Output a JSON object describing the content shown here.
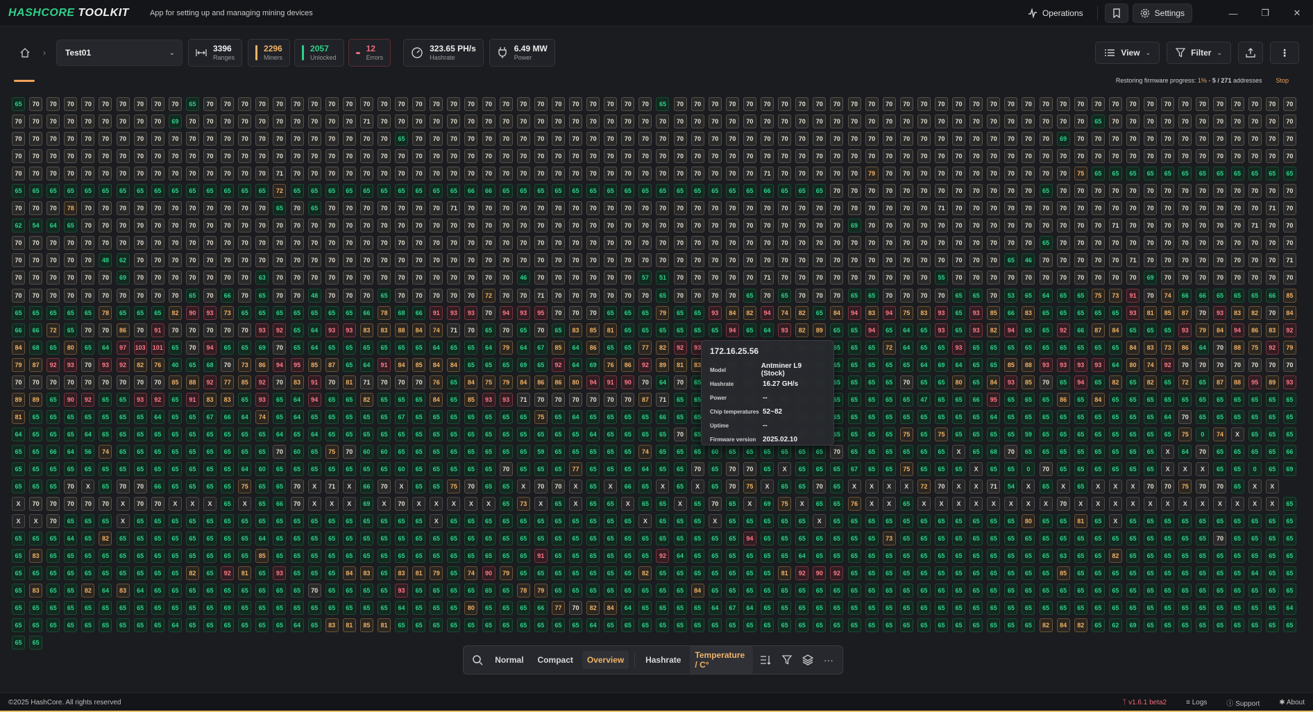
{
  "app": {
    "logo_a": "HASHCORE",
    "logo_b": "TOOLKIT",
    "tagline": "App for setting up and managing mining devices"
  },
  "titlebar": {
    "operations_label": "Operations",
    "settings_label": "Settings"
  },
  "toolbar": {
    "scan_select": "Test01",
    "stats": {
      "ranges": {
        "value": "3396",
        "label": "Ranges"
      },
      "miners": {
        "value": "2296",
        "label": "Miners"
      },
      "unlocked": {
        "value": "2057",
        "label": "Unlocked"
      },
      "errors": {
        "value": "12",
        "label": "Errors"
      },
      "hashrate": {
        "value": "323.65 PH/s",
        "label": "Hashrate"
      },
      "power": {
        "value": "6.49 MW",
        "label": "Power"
      }
    },
    "view_label": "View",
    "filter_label": "Filter"
  },
  "progress": {
    "prefix": "Restoring firmware progress: ",
    "percent": "1%",
    "sep": " - ",
    "count": "5 / 271",
    "suffix": " addresses",
    "stop_label": "Stop",
    "fraction": 0.01
  },
  "grid": {
    "rows": [
      "65 70 70 70 70 70 70 70 70 70 65 70 70 70 70 70 70 70 70 70 70 70 70 70 70 70 70 70 70 70 70 70 70 70 70 70 70 65 70 70 70 70 70 70 70 70 70 70 70 70 70 70 70 70 70 70 70 70 70 70 70 70 70 70 70 70 70 70 70 70 70 70 70 70",
      "70 70 70 70 70 70 70 70 70 69 70 70 70 70 70 70 70 70 70 70 71 70 70 70 70 70 70 70 70 70 70 70 70 70 70 70 70 70 70 70 70 70 70 70 70 70 70 70 70 70 70 70 70 70 70 70 70 70 70 70 70 70 65 70 70 70 70 70 70 70 70 70 70 70",
      "70 70 70 70 70 70 70 70 70 70 70 70 70 70 70 70 70 70 70 70 70 70 65 70 70 70 70 70 70 70 70 70 70 70 70 70 70 70 70 70 70 70 70 70 70 70 70 70 70 70 70 70 70 70 70 70 70 70 70 70 69 70 70 70 70 70 70 70 70 70 70 70 70 70",
      "70 70 70 70 70 70 70 70 70 70 70 70 70 70 70 70 70 70 70 70 70 70 70 70 70 70 70 70 70 70 70 70 70 70 70 70 70 70 70 70 70 70 70 70 70 70 70 70 70 70 70 70 70 70 70 70 70 70 70 70 70 70 70 70 70 70 70 70 70 70 70 70 70 70",
      "70 70 70 70 70 70 70 70 70 70 70 70 70 70 70 71 70 70 70 70 70 70 70 70 70 70 70 70 70 70 70 70 70 70 70 70 70 70 70 70 70 70 70 71 70 70 70 70 70 79 70 70 70 70 70 70 70 70 70 70 70 75 65 65 65 65 65 65 65 65 65 65 65 65",
      "65 65 65 65 65 65 65 65 65 65 65 65 65 65 65 72 65 65 65 65 65 65 65 65 65 65 66 66 65 65 65 65 65 65 65 65 65 65 65 65 65 65 65 66 65 65 65 70 70 70 70 70 70 70 70 70 70 70 70 65 70 70 70 70 70 70 70 70 70 70 70 70 70 70",
      "70 70 70 78 70 70 70 70 70 70 70 70 70 70 70 65 70 65 70 70 70 70 70 70 70 71 70 70 70 70 70 70 70 70 70 70 70 70 70 70 70 70 70 70 70 70 70 70 70 70 70 70 70 71 70 70 70 70 70 70 70 70 70 70 70 70 70 70 70 70 70 70 71 70",
      "62 54 64 65 70 70 70 70 70 70 70 70 70 70 70 70 70 70 70 70 70 70 70 70 70 70 70 70 70 70 70 70 70 70 70 70 70 70 70 70 70 70 70 70 70 70 70 70 69 70 70 70 70 70 70 70 70 70 70 70 70 70 70 71 70 70 70 70 70 70 70 71 70 70",
      "70 70 70 70 70 70 70 70 70 70 70 70 70 70 70 70 70 70 70 70 70 70 70 70 70 70 70 70 70 70 70 70 70 70 70 70 70 70 70 70 70 70 70 70 70 70 70 70 70 70 70 70 70 70 70 70 70 70 70 65 70 70 70 70 70 70 70 70 70 70 70 70 70 70",
      "70 70 70 70 70 48 62 70 70 70 70 70 70 70 70 70 70 70 70 70 70 70 70 70 70 70 70 70 70 70 70 70 70 70 70 70 70 70 70 70 70 70 70 70 70 70 70 70 70 70 70 70 70 70 70 70 70 65 46 70 70 70 70 70 71 70 70 70 70 70 70 70 70 71",
      "70 70 70 70 70 70 69 70 70 70 70 70 70 70 63 70 70 70 70 70 70 70 70 70 70 70 70 70 70 46 70 70 70 70 70 70 57 51 70 70 70 70 70 71 70 70 70 70 70 70 70 70 70 55 70 70 70 70 70 70 70 70 70 70 70 69 70 70 70 70 70 70 70 70",
      "70 70 70 70 70 70 70 70 70 70 65 70 66 70 65 70 70 48 70 70 70 65 70 70 70 70 70 72 70 70 71 70 70 70 70 70 70 65 70 70 70 70 65 70 65 70 70 70 65 65 70 70 70 70 65 65 70 53 65 64 65 65 75 73 91 70 74 66 66 65 65 65 66 85",
      "65 65 65 65 65 78 65 65 65 82 90 93 73 65 65 65 65 65 65 65 66 78 68 66 91 93 93 70 94 93 95 70 70 70 65 65 65 79 65 65 93 84 82 94 74 82 65 84 94 83 94 75 83 93 65 93 85 66 83 65 65 65 65 65 93 81 85 87 70 93 83 82 70 84",
      "66 66 72 65 70 70 86 70 91 70 70 70 70 70 93 92 65 64 93 93 83 83 88 84 74 71 70 65 70 65 70 65 83 85 81 65 65 65 65 65 65 94 65 64 93 82 89 65 65 94 65 64 65 93 65 93 82 94 65 65 92 66 87 84 65 65 65 93 79 84 94 86 83 92",
      "84 68 65 80 65 64 97 103 101 65 70 94 65 65 69 70 65 64 65 65 65 65 65 65 64 65 65 64 79 64 67 85 64 86 65 65 77 82 92 93 65 65 65 65 65 65 65 65 65 65 72 64 65 65 93 65 65 65 65 65 65 65 65 65 84 83 73 86 64 70 88 75 92 79",
      "79 87 92 93 70 93 92 82 76 40 65 68 70 73 86 94 95 85 87 65 64 91 84 85 84 84 65 65 65 69 65 92 64 69 76 86 92 89 81 83 65 65 65 65 65 65 65 65 65 65 65 65 64 69 64 65 65 85 88 93 93 93 93 64 80 74 92 70 70 70 70 70 70 70",
      "70 70 70 70 70 70 70 70 70 85 88 92 77 85 92 70 83 91 70 81 71 70 70 70 76 65 84 75 79 84 86 86 80 94 91 90 70 64 70 65 65 65 65 65 65 65 65 65 65 65 65 70 65 65 80 65 84 93 85 70 65 94 65 82 65 82 65 72 65 87 88 95 89 93",
      "89 89 65 90 92 65 65 93 92 65 91 83 83 65 93 65 64 94 65 65 82 65 65 65 84 65 85 93 93 71 70 70 70 70 70 70 87 71 65 65 65 65 65 65 65 65 65 65 65 65 65 65 47 65 65 66 95 65 65 65 86 65 84 65 65 65 65 65 65 65 65 65 65 65",
      "81 65 65 65 65 65 65 65 64 65 65 67 66 64 74 65 64 65 65 65 65 65 67 65 65 65 65 65 65 65 75 65 64 65 65 65 65 66 65 65 65 65 65 65 65 65 65 65 65 65 65 65 65 65 65 65 64 65 65 65 65 65 65 65 65 65 64 70 65 65 65 65 65 65",
      "64 65 65 65 64 65 65 65 65 65 65 65 65 65 65 64 65 64 65 65 65 65 65 65 65 65 65 65 65 65 65 65 65 64 65 65 65 65 70 65 65 65 65 65 65 65 65 65 65 65 65 75 65 75 65 65 65 65 59 65 65 65 65 65 65 65 65 75 0 74 X 65 65 65",
      "65 65 66 64 56 74 65 65 65 65 65 65 65 65 65 70 60 65 75 70 60 60 65 65 65 65 65 65 65 65 59 65 65 65 65 65 74 65 65 65 60 65 65 65 65 65 65 70 65 65 65 65 65 65 X 65 68 70 65 65 65 65 65 65 65 65 X 64 70 65 65 65 65 66",
      "65 65 65 65 65 65 65 65 65 65 65 65 65 64 60 65 65 65 65 65 65 65 60 65 65 65 65 65 70 65 65 65 77 65 65 65 64 65 65 70 65 70 70 65 X 65 65 65 67 65 65 75 65 65 65 X 65 65 0 70 65 65 65 65 65 65 X X X 65 65 0 65 69",
      "65 65 65 70 X 65 70 70 66 65 65 65 65 75 65 65 70 X 71 X 66 70 X 65 65 75 70 65 65 X 70 70 X 65 X 66 65 X 65 X 65 70 75 X 65 65 70 65 X X X X 72 70 X X 71 54 X 65 X 65 X X X 70 70 75 70 70 65 X X",
      "X 70 70 70 70 70 X 70 70 X X X 65 X 65 66 70 X X X 69 X 70 X X X X X 65 73 X 65 X 65 65 X 65 65 X 65 70 65 X 69 75 X 65 65 76 X X 65 X X X X X X X X 70 X X X X X X X X X X X X 65",
      "X X 70 65 65 65 X 65 65 65 65 65 65 65 65 65 65 65 65 65 65 65 65 65 X 65 65 65 65 65 65 65 65 65 65 65 X 65 65 65 X 65 65 65 65 65 X 65 65 65 65 65 65 65 65 65 65 65 80 65 65 81 65 X 65 65 65 65 65 65 65 65 65 65",
      "65 65 65 64 65 82 65 65 65 65 65 65 65 65 64 65 65 65 65 65 65 65 65 65 65 65 65 65 65 65 65 65 65 65 65 65 65 65 65 65 65 65 94 65 65 65 65 65 65 65 73 65 65 65 65 65 65 65 65 65 65 65 65 65 65 65 65 65 65 70 65 65 65 65",
      "65 83 65 65 65 65 65 65 65 65 65 65 65 65 85 65 65 65 65 65 65 65 65 65 65 65 65 65 65 65 91 65 65 65 65 65 65 92 64 65 65 65 65 65 65 64 65 65 65 65 65 65 65 65 65 65 65 65 65 65 63 65 65 82 65 65 65 65 65 65 65 65 65 65",
      "65 65 65 65 65 65 65 65 65 65 82 65 92 81 65 93 65 65 65 84 83 65 83 81 79 65 74 90 79 65 65 65 65 65 65 65 82 65 65 65 65 65 65 65 81 92 90 92 65 65 65 65 65 65 65 65 65 65 65 65 85 65 65 65 65 65 65 65 65 65 65 64 65 65",
      "65 83 65 65 82 64 83 64 65 65 65 65 65 65 65 65 65 70 65 65 65 65 93 65 65 65 65 65 65 78 79 65 65 65 65 65 65 65 65 84 65 65 65 65 65 65 65 65 65 65 65 65 65 65 65 65 65 65 65 65 65 65 65 65 65 65 65 65 65 65 65 65 65 65",
      "65 65 65 65 65 65 65 65 65 65 65 65 69 65 65 65 65 65 65 65 65 65 64 65 65 65 80 65 65 65 66 77 70 82 84 64 65 65 65 65 64 67 64 65 65 65 65 65 65 65 65 65 65 65 65 65 65 65 65 65 65 65 65 65 65 65 65 65 65 65 65 65 65 64",
      "65 65 65 65 65 65 65 65 65 64 65 65 65 65 65 65 64 65 83 81 85 81 65 65 65 65 65 65 65 65 65 65 65 64 65 65 65 65 65 65 65 65 65 65 65 65 65 65 65 65 65 65 65 65 65 65 65 65 65 82 84 82 65 62 69 65 65 65 65 65 65 65 65 65",
      "65 65"
    ]
  },
  "tooltip": {
    "ip": "172.16.25.56",
    "model_key": "Model",
    "model_val": "Antminer L9 (Stock)",
    "hashrate_key": "Hashrate",
    "hashrate_val": "16.27 GH/s",
    "power_key": "Power",
    "power_val": "--",
    "chip_key": "Chip temperatures",
    "chip_val": "52~82",
    "uptime_key": "Uptime",
    "uptime_val": "--",
    "fw_key": "Firmware version",
    "fw_val": "2025.02.10"
  },
  "bottombar": {
    "normal": "Normal",
    "compact": "Compact",
    "overview": "Overview",
    "hashrate": "Hashrate",
    "temperature": "Temperature / C°"
  },
  "footer": {
    "copyright": "©2025 HashCore. All rights reserved",
    "version": "v1.6.1 beta2",
    "logs": "Logs",
    "support": "Support",
    "about": "About"
  },
  "colors": {
    "accent_green": "#2fd08a",
    "accent_orange": "#f0a15a",
    "error_red": "#ef6b7a"
  }
}
